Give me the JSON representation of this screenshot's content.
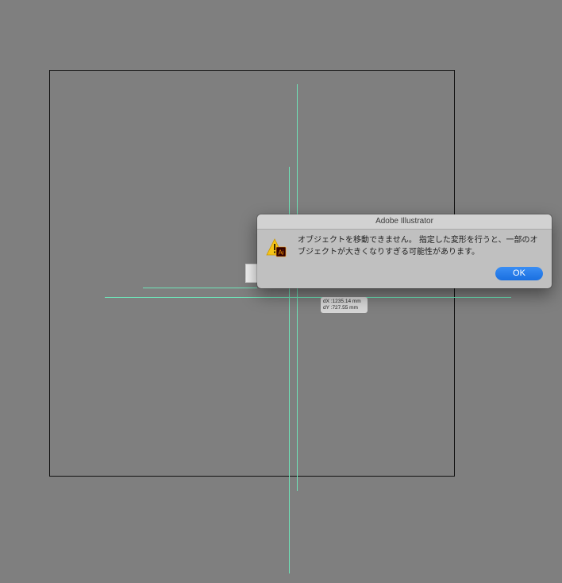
{
  "dialog": {
    "title": "Adobe Illustrator",
    "message": "オブジェクトを移動できません。 指定した変形を行うと、一部のオブジェクトが大きくなりすぎる可能性があります。",
    "ok_label": "OK",
    "icon": "warning-icon",
    "badge_text": "Ai"
  },
  "measure": {
    "dx": "dX :1235.14 mm",
    "dy": "dY :727.55 mm"
  },
  "colors": {
    "canvas": "#7f7f7f",
    "guide": "#6fe3b8",
    "dialog_bg": "#c0c0c0",
    "ok_button": "#1a6fe0",
    "warning": "#f6c417",
    "ai_badge": "#330000",
    "ai_text": "#ff9a00"
  }
}
